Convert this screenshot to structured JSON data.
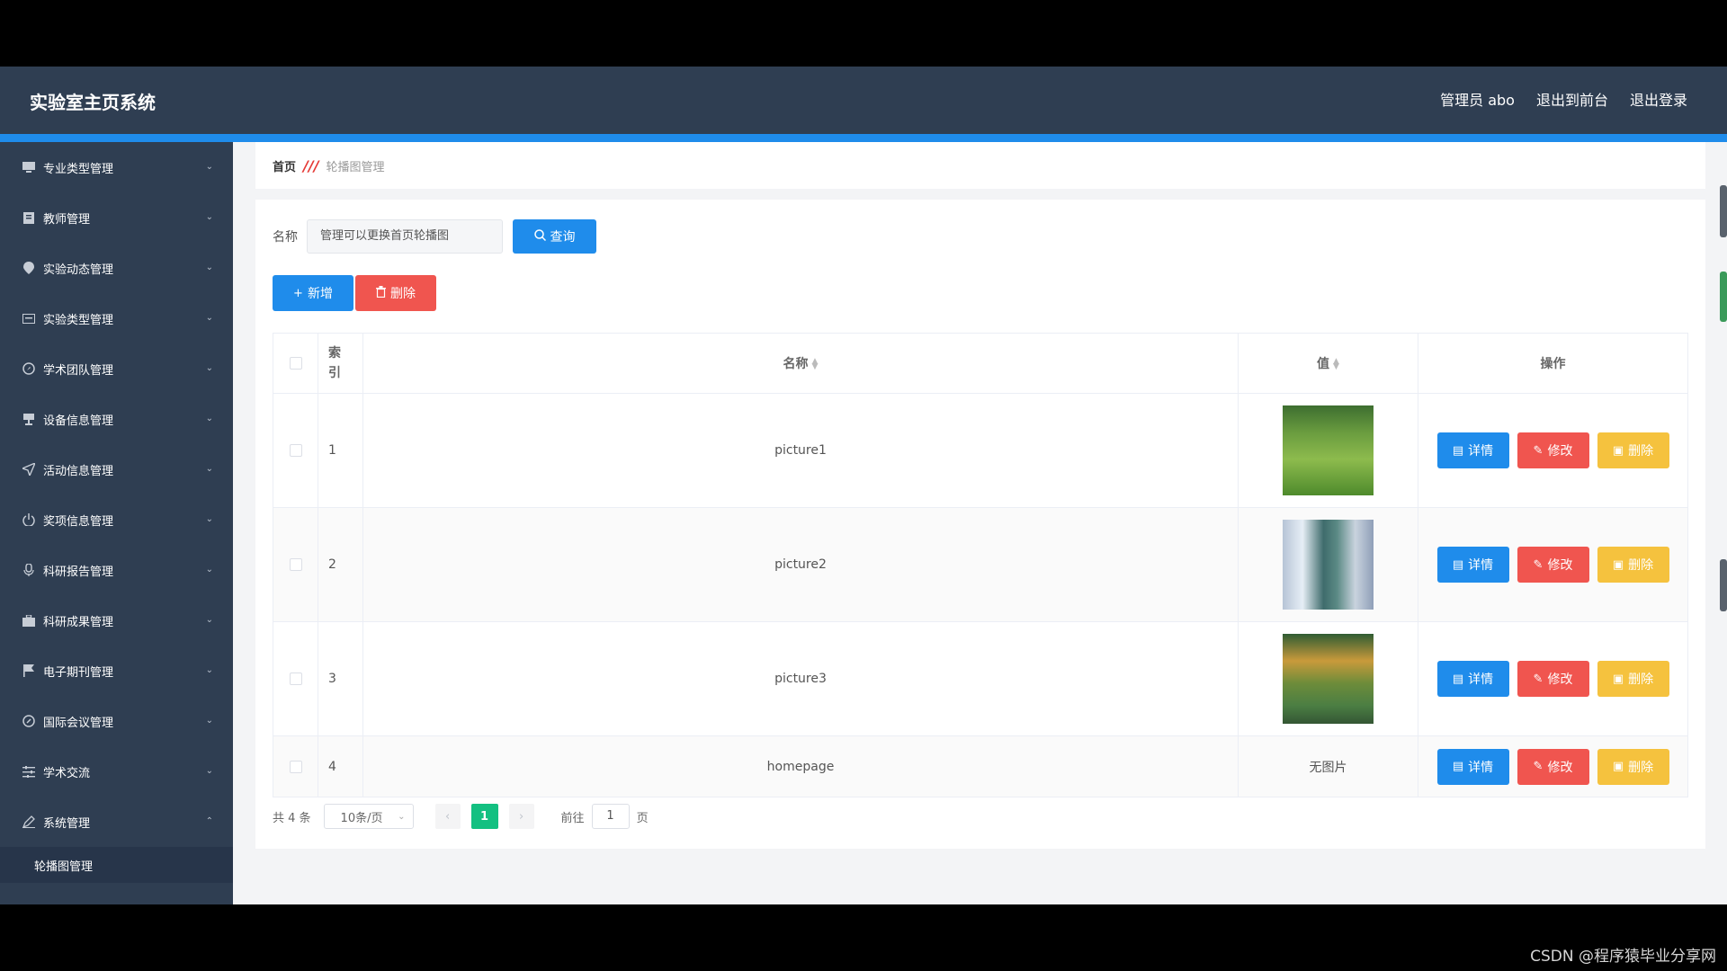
{
  "header": {
    "title": "实验室主页系统",
    "user": "管理员 abo",
    "to_front": "退出到前台",
    "logout": "退出登录"
  },
  "sidebar": {
    "items": [
      {
        "label": "专业类型管理",
        "icon": "monitor-icon"
      },
      {
        "label": "教师管理",
        "icon": "clipboard-icon"
      },
      {
        "label": "实验动态管理",
        "icon": "location-icon"
      },
      {
        "label": "实验类型管理",
        "icon": "card-icon"
      },
      {
        "label": "学术团队管理",
        "icon": "compass-icon"
      },
      {
        "label": "设备信息管理",
        "icon": "trophy-icon"
      },
      {
        "label": "活动信息管理",
        "icon": "send-icon"
      },
      {
        "label": "奖项信息管理",
        "icon": "power-icon"
      },
      {
        "label": "科研报告管理",
        "icon": "microphone-icon"
      },
      {
        "label": "科研成果管理",
        "icon": "briefcase-icon"
      },
      {
        "label": "电子期刊管理",
        "icon": "flag-icon"
      },
      {
        "label": "国际会议管理",
        "icon": "globe-icon"
      },
      {
        "label": "学术交流",
        "icon": "sliders-icon"
      },
      {
        "label": "系统管理",
        "icon": "pen-icon"
      }
    ],
    "sub_item": "轮播图管理"
  },
  "breadcrumb": {
    "home": "首页",
    "current": "轮播图管理"
  },
  "search": {
    "label": "名称",
    "value": "管理可以更换首页轮播图",
    "button": "查询"
  },
  "actions": {
    "add": "新增",
    "delete": "删除"
  },
  "table": {
    "headers": {
      "index": "索引",
      "name": "名称",
      "value": "值",
      "ops": "操作"
    },
    "rows": [
      {
        "index": "1",
        "name": "picture1",
        "has_image": true
      },
      {
        "index": "2",
        "name": "picture2",
        "has_image": true
      },
      {
        "index": "3",
        "name": "picture3",
        "has_image": true
      },
      {
        "index": "4",
        "name": "homepage",
        "has_image": false,
        "value_text": "无图片"
      }
    ],
    "op_labels": {
      "detail": "详情",
      "edit": "修改",
      "delete": "删除"
    }
  },
  "pagination": {
    "total": "共 4 条",
    "page_size": "10条/页",
    "current_page": "1",
    "goto_label": "前往",
    "goto_value": "1",
    "page_suffix": "页"
  },
  "watermark": "CSDN @程序猿毕业分享网",
  "colors": {
    "sidebar": "#2f3e52",
    "primary": "#1f8ceb",
    "danger": "#f0554f",
    "warning": "#f5c23e",
    "page_active": "#13c081"
  }
}
